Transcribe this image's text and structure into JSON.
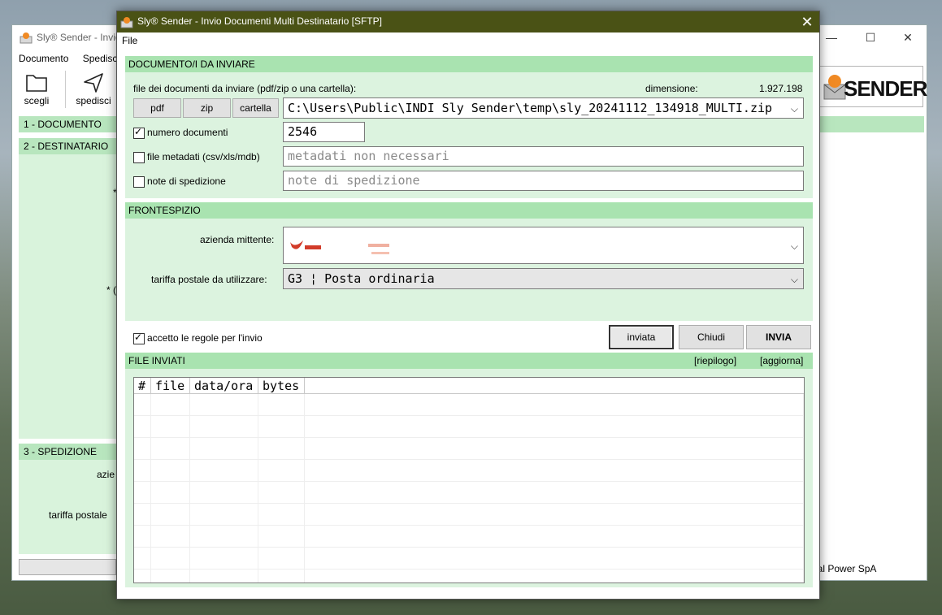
{
  "background_window": {
    "title": "Sly® Sender - Invio",
    "menu": [
      "Documento",
      "Spedisci"
    ],
    "toolbar": [
      {
        "label": "scegli",
        "icon": "folder-icon"
      },
      {
        "label": "spedisci",
        "icon": "send-icon"
      }
    ],
    "sections": {
      "documento": "1 - DOCUMENTO",
      "destinatario": "2 - DESTINATARIO",
      "spedizione": "3 - SPEDIZIONE"
    },
    "partial_labels": {
      "star1": "*",
      "star2": "* (",
      "azienda": "azie",
      "tariffa": "tariffa postale"
    },
    "footer_text": "bal Power SpA",
    "logo_text": "SENDER"
  },
  "dialog": {
    "title": "Sly® Sender - Invio Documenti Multi Destinatario [SFTP]",
    "menu_file": "File",
    "section_documenti": "DOCUMENTO/I DA INVIARE",
    "file_label": "file dei documenti da inviare (pdf/zip o una cartella):",
    "dimensione_label": "dimensione:",
    "dimensione_value": "1.927.198",
    "btn_pdf": "pdf",
    "btn_zip": "zip",
    "btn_cartella": "cartella",
    "file_path": "C:\\Users\\Public\\INDI Sly Sender\\temp\\sly_20241112_134918_MULTI.zip",
    "numero_documenti_label": "numero documenti",
    "numero_documenti_checked": true,
    "numero_documenti_value": "2546",
    "metadati_label": "file metadati (csv/xls/mdb)",
    "metadati_checked": false,
    "metadati_placeholder": "metadati non necessari",
    "note_label": "note di spedizione",
    "note_checked": false,
    "note_placeholder": "note di spedizione",
    "section_frontespizio": "FRONTESPIZIO",
    "azienda_label": "azienda mittente:",
    "tariffa_label": "tariffa postale da utilizzare:",
    "tariffa_value": "G3 ¦ Posta ordinaria",
    "accetto_label": "accetto le regole per l'invio",
    "accetto_checked": true,
    "btn_inviata": "inviata",
    "btn_chiudi": "Chiudi",
    "btn_invia": "INVIA",
    "section_file_inviati": "FILE INVIATI",
    "link_riepilogo": "[riepilogo]",
    "link_aggiorna": "[aggiorna]",
    "table_headers": [
      "#",
      "file",
      "data/ora",
      "bytes"
    ]
  },
  "colors": {
    "title_bar": "#4a5215",
    "section_band": "#a9e3b0",
    "panel": "#dcf3df",
    "brand_orange": "#f08a24"
  }
}
